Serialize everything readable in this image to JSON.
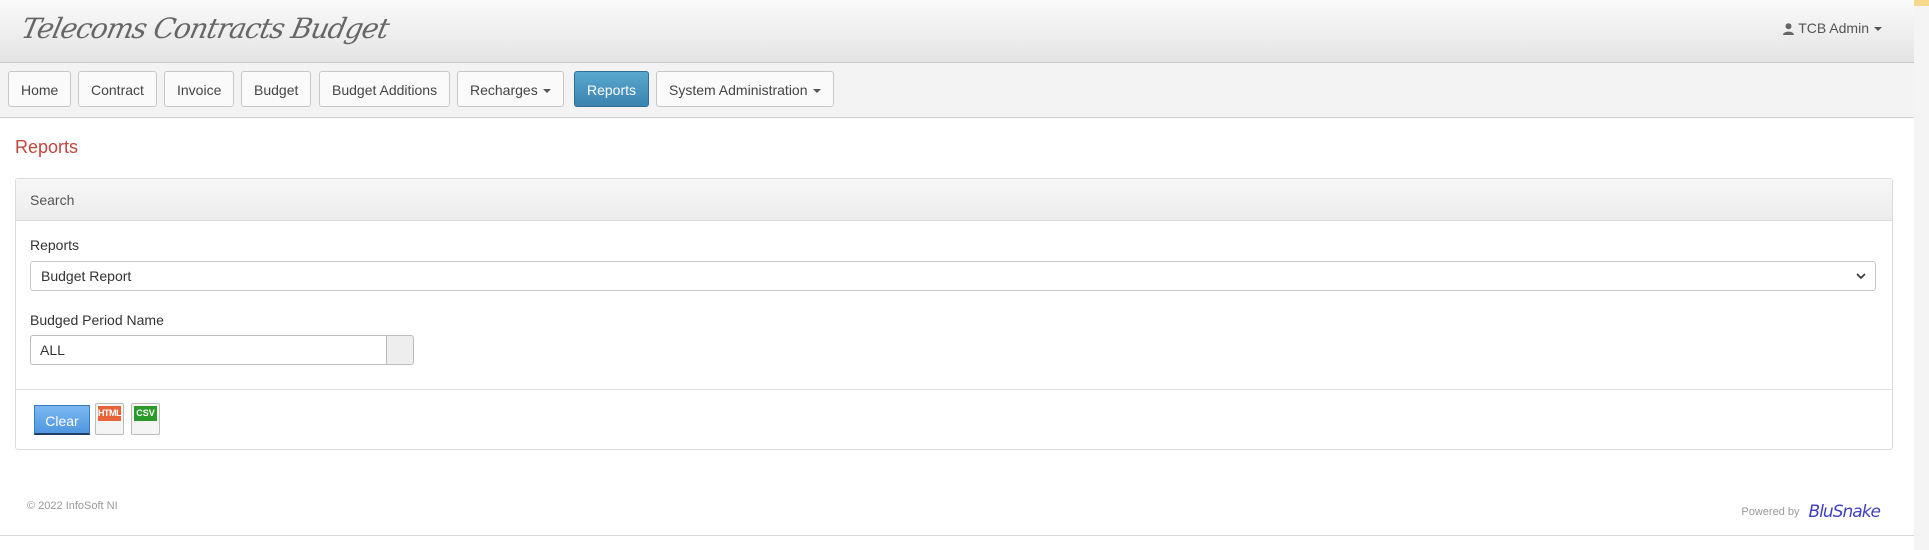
{
  "header": {
    "brand": "Telecoms Contracts Budget",
    "user": "TCB Admin"
  },
  "nav": {
    "items": [
      {
        "label": "Home"
      },
      {
        "label": "Contract"
      },
      {
        "label": "Invoice"
      },
      {
        "label": "Budget"
      },
      {
        "label": "Budget Additions"
      },
      {
        "label": "Recharges"
      },
      {
        "label": "Reports"
      },
      {
        "label": "System Administration"
      }
    ],
    "active": "Reports"
  },
  "page": {
    "title": "Reports"
  },
  "search_panel": {
    "title": "Search",
    "reports_label": "Reports",
    "reports_selected": "Budget Report",
    "period_label": "Budged Period Name",
    "period_value": "ALL",
    "clear_label": "Clear",
    "html_label": "HTML",
    "csv_label": "CSV"
  },
  "footer": {
    "copyright": "© 2022 InfoSoft NI",
    "powered_by": "Powered by",
    "vendor": "BluSnake"
  },
  "colors": {
    "accent": "#3c83b0",
    "title": "#c0463e",
    "clear_button": "#4f96e0",
    "html_tag": "#e8623a",
    "csv_tag": "#2a9a2a"
  },
  "icons": {
    "user": "user-icon",
    "dropdown": "caret-down-icon",
    "select": "chevron-down-icon"
  }
}
